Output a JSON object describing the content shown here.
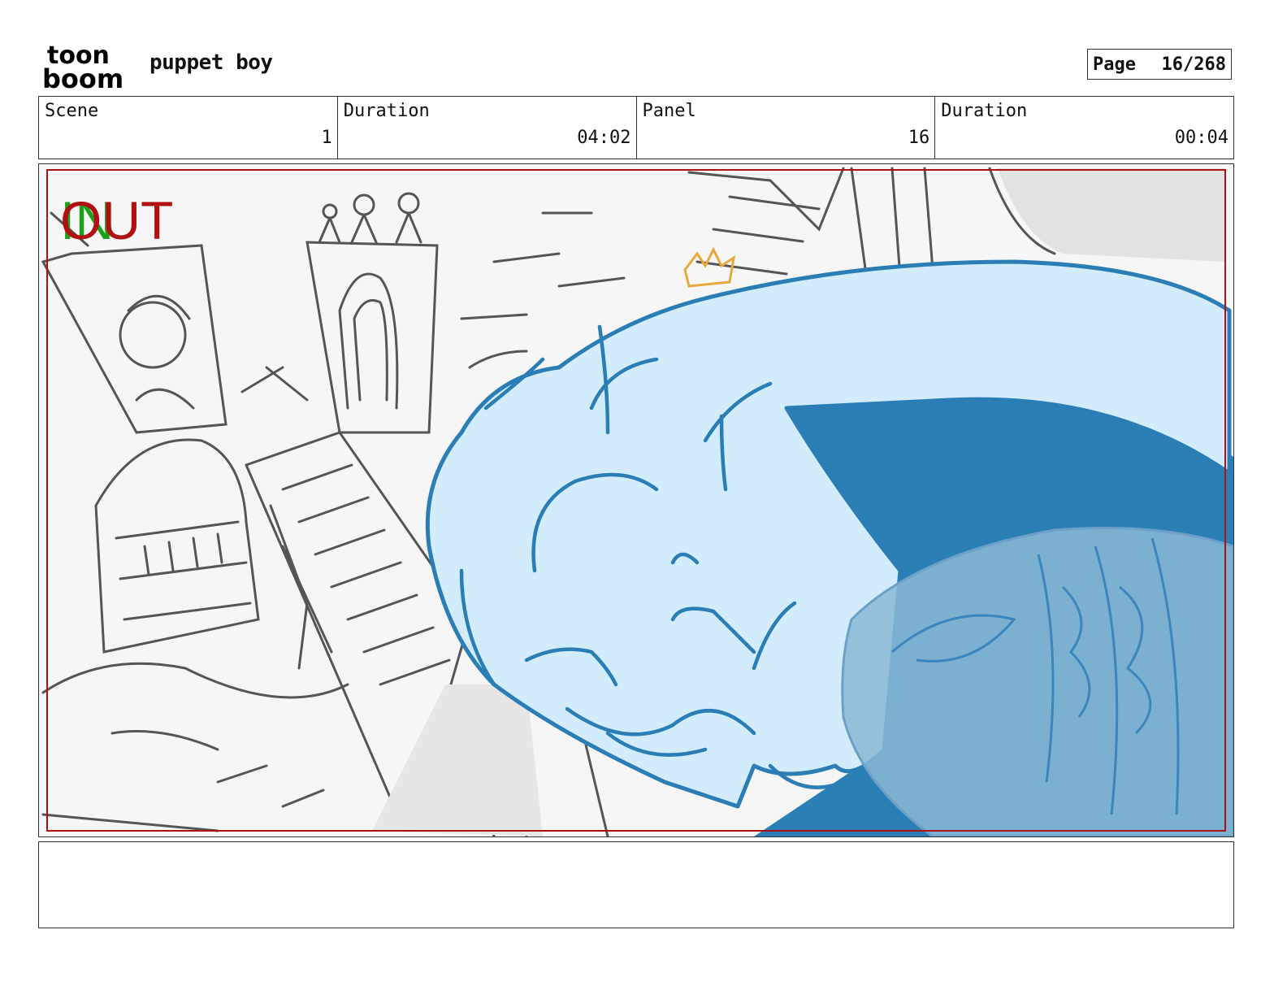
{
  "header": {
    "logo": {
      "top": "toon",
      "bottom": "boom"
    },
    "project_title": "puppet boy",
    "page_label": "Page",
    "page_number": "16/268"
  },
  "info": {
    "scene_label": "Scene",
    "scene_value": "1",
    "scene_duration_label": "Duration",
    "scene_duration_value": "04:02",
    "panel_label": "Panel",
    "panel_value": "16",
    "panel_duration_label": "Duration",
    "panel_duration_value": "00:04"
  },
  "panel_marks": {
    "in": "IN",
    "out": "OUT"
  },
  "notes": {
    "text": ""
  },
  "colors": {
    "sketch_gray": "#555555",
    "character_light_blue": "#d3ecfb",
    "character_line_blue": "#2a7db5",
    "character_dark_blue": "#2a7fb5",
    "frame_red": "#b01010",
    "in_green": "#1ea01e"
  }
}
